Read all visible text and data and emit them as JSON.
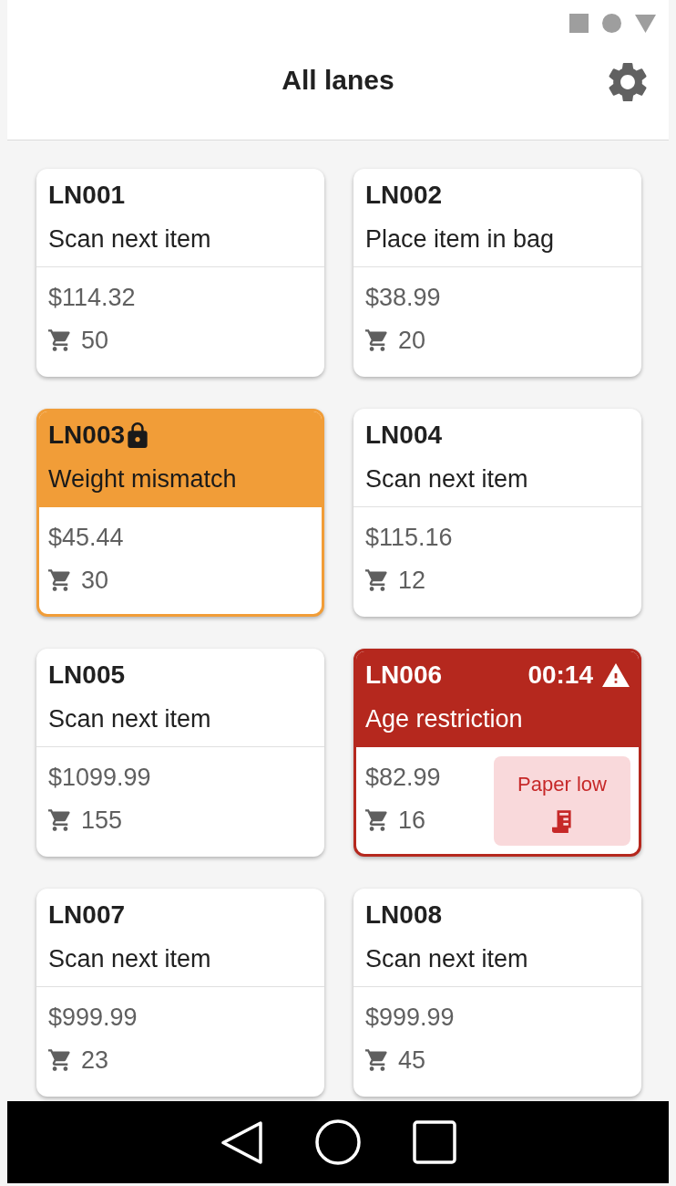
{
  "app_bar": {
    "title": "All lanes"
  },
  "lanes": [
    {
      "id": "LN001",
      "kind": "normal",
      "locked": false,
      "status": "Scan next item",
      "total": "$114.32",
      "items": "50"
    },
    {
      "id": "LN002",
      "kind": "normal",
      "locked": false,
      "status": "Place item in bag",
      "total": "$38.99",
      "items": "20"
    },
    {
      "id": "LN003",
      "kind": "warning",
      "locked": true,
      "status": "Weight mismatch",
      "total": "$45.44",
      "items": "30"
    },
    {
      "id": "LN004",
      "kind": "normal",
      "locked": false,
      "status": "Scan next item",
      "total": "$115.16",
      "items": "12"
    },
    {
      "id": "LN005",
      "kind": "normal",
      "locked": false,
      "status": "Scan next item",
      "total": "$1099.99",
      "items": "155"
    },
    {
      "id": "LN006",
      "kind": "alert",
      "locked": false,
      "timer": "00:14",
      "status": "Age restriction",
      "total": "$82.99",
      "items": "16",
      "notice": "Paper low"
    },
    {
      "id": "LN007",
      "kind": "normal",
      "locked": false,
      "status": "Scan next item",
      "total": "$999.99",
      "items": "23"
    },
    {
      "id": "LN008",
      "kind": "normal",
      "locked": false,
      "status": "Scan next item",
      "total": "$999.99",
      "items": "45"
    }
  ]
}
